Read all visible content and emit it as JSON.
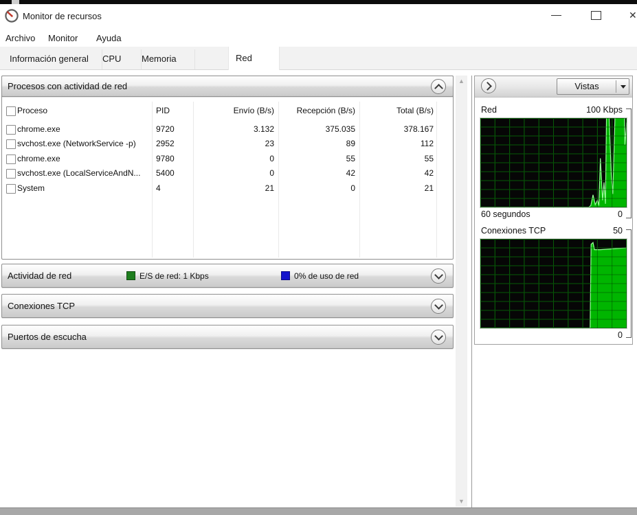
{
  "window": {
    "title": "Monitor de recursos"
  },
  "menu": {
    "items": [
      "Archivo",
      "Monitor",
      "Ayuda"
    ]
  },
  "tabs": [
    {
      "label": "Información general",
      "active": false
    },
    {
      "label": "CPU",
      "active": false
    },
    {
      "label": "Memoria",
      "active": false
    },
    {
      "label": "Red",
      "active": true
    }
  ],
  "processes_panel": {
    "title": "Procesos con actividad de red",
    "columns": [
      "Proceso",
      "PID",
      "Envío (B/s)",
      "Recepción (B/s)",
      "Total (B/s)"
    ],
    "rows": [
      {
        "name": "chrome.exe",
        "pid": "9720",
        "send": "3.132",
        "recv": "375.035",
        "total": "378.167"
      },
      {
        "name": "svchost.exe (NetworkService -p)",
        "pid": "2952",
        "send": "23",
        "recv": "89",
        "total": "112"
      },
      {
        "name": "chrome.exe",
        "pid": "9780",
        "send": "0",
        "recv": "55",
        "total": "55"
      },
      {
        "name": "svchost.exe (LocalServiceAndN...",
        "pid": "5400",
        "send": "0",
        "recv": "42",
        "total": "42"
      },
      {
        "name": "System",
        "pid": "4",
        "send": "21",
        "recv": "0",
        "total": "21"
      }
    ]
  },
  "network_activity_panel": {
    "title": "Actividad de red",
    "legend": [
      {
        "color": "#1e7e1e",
        "label": "E/S de red: 1 Kbps"
      },
      {
        "color": "#1414cc",
        "label": "0% de uso de red"
      }
    ]
  },
  "tcp_panel": {
    "title": "Conexiones TCP"
  },
  "ports_panel": {
    "title": "Puertos de escucha"
  },
  "right_panel": {
    "views_label": "Vistas"
  },
  "chart_data": [
    {
      "type": "area",
      "title": "Red",
      "ymax_label": "100 Kbps",
      "ymin_label": "0",
      "xlabel": "60 segundos",
      "ylim": [
        0,
        100
      ],
      "grid": "10x10",
      "legend_position": "none",
      "colors": {
        "background": "#060606",
        "grid": "#0e7a0e",
        "fill": "#00c400",
        "line": "#98ff98"
      },
      "points": [
        [
          0,
          0
        ],
        [
          0.74,
          0
        ],
        [
          0.755,
          2
        ],
        [
          0.77,
          14
        ],
        [
          0.785,
          3
        ],
        [
          0.8,
          8
        ],
        [
          0.81,
          2
        ],
        [
          0.82,
          55
        ],
        [
          0.835,
          8
        ],
        [
          0.845,
          28
        ],
        [
          0.855,
          4
        ],
        [
          0.862,
          100
        ],
        [
          0.88,
          100
        ],
        [
          0.895,
          35
        ],
        [
          0.905,
          15
        ],
        [
          0.92,
          100
        ],
        [
          0.985,
          100
        ],
        [
          0.988,
          70
        ],
        [
          1,
          95
        ]
      ]
    },
    {
      "type": "area",
      "title": "Conexiones TCP",
      "ymax_label": "50",
      "ymin_label": "0",
      "xlabel": "",
      "ylim": [
        0,
        50
      ],
      "grid": "10x10",
      "legend_position": "none",
      "colors": {
        "background": "#060606",
        "grid": "#0e7a0e",
        "fill": "#00c400",
        "line": "#98ff98"
      },
      "points": [
        [
          0,
          0
        ],
        [
          0.75,
          0
        ],
        [
          0.757,
          47
        ],
        [
          0.77,
          48
        ],
        [
          0.78,
          44
        ],
        [
          0.82,
          44
        ],
        [
          1,
          45
        ]
      ]
    }
  ]
}
